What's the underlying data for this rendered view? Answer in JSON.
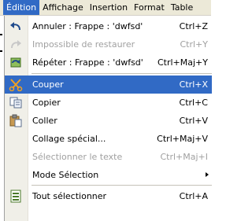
{
  "menubar": {
    "items": [
      {
        "label": "Édition"
      },
      {
        "label": "Affichage"
      },
      {
        "label": "Insertion"
      },
      {
        "label": "Format"
      },
      {
        "label": "Table"
      }
    ]
  },
  "menu": {
    "items": [
      {
        "label": "Annuler : Frappe : 'dwfsd'",
        "shortcut": "Ctrl+Z",
        "icon": "undo-icon",
        "enabled": true
      },
      {
        "label": "Impossible de restaurer",
        "shortcut": "Ctrl+Y",
        "icon": "redo-icon",
        "enabled": false
      },
      {
        "label": "Répéter : Frappe : 'dwfsd'",
        "shortcut": "Ctrl+Maj+Y",
        "icon": "repeat-icon",
        "enabled": true
      },
      {
        "label": "Couper",
        "shortcut": "Ctrl+X",
        "icon": "scissors-icon",
        "enabled": true,
        "selected": true
      },
      {
        "label": "Copier",
        "shortcut": "Ctrl+C",
        "icon": "copy-icon",
        "enabled": true
      },
      {
        "label": "Coller",
        "shortcut": "Ctrl+V",
        "icon": "paste-icon",
        "enabled": true
      },
      {
        "label": "Collage spécial...",
        "shortcut": "Ctrl+Maj+V",
        "enabled": true
      },
      {
        "label": "Sélectionner le texte",
        "shortcut": "Ctrl+Maj+I",
        "enabled": false
      },
      {
        "label": "Mode Sélection",
        "shortcut": "",
        "enabled": true,
        "submenu": true
      },
      {
        "label": "Tout sélectionner",
        "shortcut": "Ctrl+A",
        "icon": "select-all-icon",
        "enabled": true
      }
    ]
  },
  "colors": {
    "highlight": "#316ac5",
    "menubar_bg": "#ece9d8",
    "disabled_text": "#a0a0a0"
  }
}
